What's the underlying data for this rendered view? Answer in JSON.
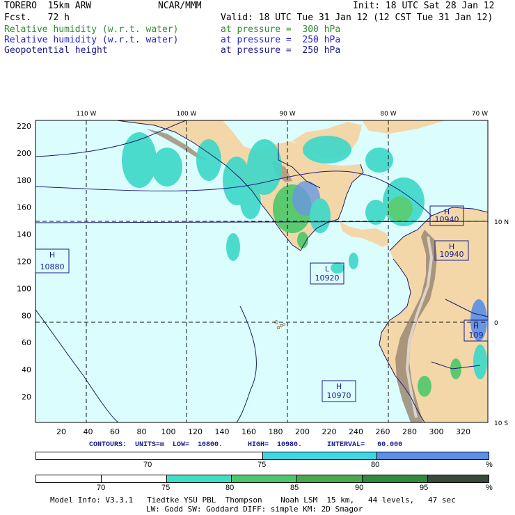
{
  "header": {
    "model": "TORERO  15km ARW",
    "org": "NCAR/MMM",
    "init": "Init: 18 UTC Sat 28 Jan 12",
    "fcst": "Fcst.   72 h",
    "valid": "Valid: 18 UTC Tue 31 Jan 12 (12 CST Tue 31 Jan 12)",
    "fields": [
      {
        "name": "Relative humidity (w.r.t. water)",
        "level": "at pressure =  300 hPa",
        "color": "#2e8b2e"
      },
      {
        "name": "Relative humidity (w.r.t. water)",
        "level": "at pressure =  250 hPa",
        "color": "#2222cc"
      },
      {
        "name": "Geopotential height",
        "level": "at pressure =  250 hPa",
        "color": "#1a1a8a"
      }
    ]
  },
  "map": {
    "lon_labels": [
      "110 W",
      "100 W",
      "90 W",
      "80 W",
      "70 W"
    ],
    "lat_labels": [
      "10 N",
      "0",
      "10 S"
    ],
    "y_ticks": [
      "220",
      "200",
      "180",
      "160",
      "140",
      "120",
      "100",
      "80",
      "60",
      "40",
      "20"
    ],
    "x_ticks": [
      "20",
      "40",
      "60",
      "80",
      "100",
      "120",
      "140",
      "160",
      "180",
      "200",
      "220",
      "240",
      "260",
      "280",
      "300",
      "320"
    ],
    "highs_lows": [
      {
        "type": "H",
        "value": "10940"
      },
      {
        "type": "H",
        "value": "10940"
      },
      {
        "type": "H",
        "value": "10880"
      },
      {
        "type": "L",
        "value": "10920"
      },
      {
        "type": "H",
        "value": "109"
      },
      {
        "type": "H",
        "value": "10970"
      }
    ],
    "colors": {
      "ocean": "#dcfdfd",
      "land": "#f3d7a8",
      "terrain_dark": "#8c7a66",
      "rh_light": "#3cd8c8",
      "rh_mid": "#4caa5a",
      "rh_dark": "#2f8a3a",
      "rh_blue": "#5a90e8"
    }
  },
  "contours": {
    "label": "CONTOURS:  UNITS=m  LOW=  10800.      HIGH=  10980.      INTERVAL=   60.000"
  },
  "colorbar1": {
    "labels": [
      "70",
      "75",
      "80",
      "%"
    ],
    "colors": [
      "#ffffff",
      "#3cd8e8",
      "#5a90e8"
    ]
  },
  "colorbar2": {
    "labels": [
      "70",
      "75",
      "80",
      "85",
      "90",
      "95",
      "%"
    ],
    "colors": [
      "#ffffff",
      "#ffffff",
      "#3ce0c8",
      "#4cc86a",
      "#4aa84a",
      "#2f8a3a",
      "#3a4a3a"
    ]
  },
  "footer": {
    "line1": "Model Info: V3.3.1   Tiedtke YSU PBL  Thompson    Noah LSM  15 km,   44 levels,   47 sec",
    "line2": "LW: Godd SW: Goddard DIFF: simple KM: 2D Smagor"
  }
}
